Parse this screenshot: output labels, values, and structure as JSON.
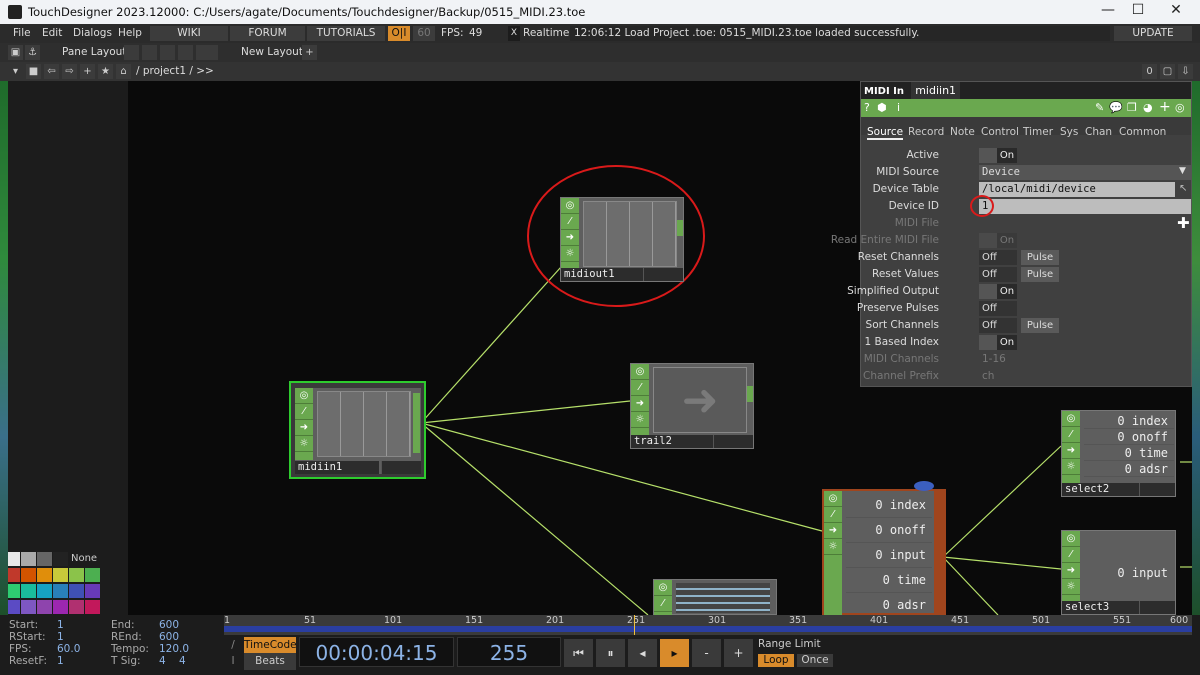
{
  "window": {
    "title": "TouchDesigner 2023.12000: C:/Users/agate/Documents/Touchdesigner/Backup/0515_MIDI.23.toe",
    "min": "—",
    "max": "☐",
    "close": "✕"
  },
  "menu": {
    "items": [
      "File",
      "Edit",
      "Dialogs",
      "Help"
    ],
    "buttons": [
      "WIKI",
      "FORUM",
      "TUTORIALS"
    ],
    "oi": "O|I",
    "fps_lock": "60",
    "fps_label": "FPS:",
    "fps_value": "49",
    "realtime_box": "X",
    "realtime": "Realtime",
    "status": "12:06:12 Load Project .toe: 0515_MIDI.23.toe loaded successfully.",
    "update": "UPDATE"
  },
  "toolbar": {
    "pane_layout": "Pane Layout",
    "new_layout": "New Layout",
    "plus": "+"
  },
  "pathbar": {
    "path": "/ project1 / >>",
    "zero": "0"
  },
  "nodes": {
    "midiout": {
      "name": "midiout1"
    },
    "midiin": {
      "name": "midiin1"
    },
    "trail": {
      "name": "trail2"
    },
    "select2": {
      "name": "select2",
      "channels": [
        "0 index",
        "0 onoff",
        "0 time",
        "0 adsr"
      ]
    },
    "select3": {
      "name": "select3",
      "channels": [
        "0 input"
      ]
    },
    "merge": {
      "channels": [
        "0 index",
        "0 onoff",
        "0 input",
        "0 time",
        "0 adsr"
      ]
    }
  },
  "param": {
    "type": "MIDI In",
    "name": "midiin1",
    "tabs": [
      "Source",
      "Record",
      "Note",
      "Control",
      "Timer",
      "Sys",
      "Chan",
      "Common"
    ],
    "rows": [
      {
        "label": "Active",
        "kind": "toggle",
        "value": "On"
      },
      {
        "label": "MIDI Source",
        "kind": "menu",
        "value": "Device"
      },
      {
        "label": "Device Table",
        "kind": "field",
        "value": "/local/midi/device"
      },
      {
        "label": "Device ID",
        "kind": "field",
        "value": "1"
      },
      {
        "label": "MIDI File",
        "kind": "dim",
        "value": ""
      },
      {
        "label": "Read Entire MIDI File",
        "kind": "dimtoggle",
        "value": "On"
      },
      {
        "label": "Reset Channels",
        "kind": "pulse",
        "value": "Off",
        "pulse": "Pulse"
      },
      {
        "label": "Reset Values",
        "kind": "pulse",
        "value": "Off",
        "pulse": "Pulse"
      },
      {
        "label": "Simplified Output",
        "kind": "toggle",
        "value": "On"
      },
      {
        "label": "Preserve Pulses",
        "kind": "off",
        "value": "Off"
      },
      {
        "label": "Sort Channels",
        "kind": "pulse",
        "value": "Off",
        "pulse": "Pulse"
      },
      {
        "label": "1 Based Index",
        "kind": "toggle",
        "value": "On"
      },
      {
        "label": "MIDI Channels",
        "kind": "dimtext",
        "value": "1-16"
      },
      {
        "label": "Channel Prefix",
        "kind": "dimtext",
        "value": "ch"
      }
    ]
  },
  "palette": {
    "none": "None"
  },
  "timeinfo": {
    "left": [
      [
        "Start:",
        "1"
      ],
      [
        "RStart:",
        "1"
      ],
      [
        "FPS:",
        "60.0"
      ],
      [
        "ResetF:",
        "1"
      ]
    ],
    "right": [
      [
        "End:",
        "600"
      ],
      [
        "REnd:",
        "600"
      ],
      [
        "Tempo:",
        "120.0"
      ],
      [
        "T Sig:",
        "4    4"
      ]
    ]
  },
  "ruler": [
    "1",
    "51",
    "101",
    "151",
    "201",
    "251",
    "301",
    "351",
    "401",
    "451",
    "501",
    "551",
    "600"
  ],
  "transport": {
    "timecode": "TimeCode",
    "beats": "Beats",
    "time": "00:00:04:15",
    "frame": "255",
    "range": "Range Limit",
    "loop": "Loop",
    "once": "Once",
    "slash": "/",
    "i": "I",
    "btn_start": "⏮",
    "btn_pause": "⏸",
    "btn_back": "◂",
    "btn_play": "▸",
    "btn_minus": "-",
    "btn_plus": "+"
  }
}
